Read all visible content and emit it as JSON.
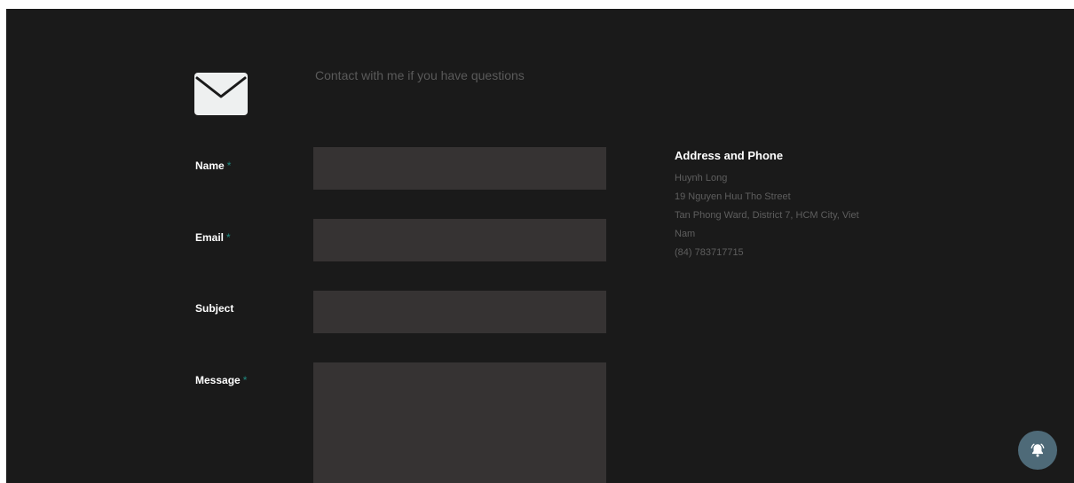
{
  "header": {
    "icon": "envelope-icon",
    "intro_text": "Contact with me if you have questions"
  },
  "form": {
    "required_mark": "*",
    "fields": [
      {
        "label": "Name",
        "required": true,
        "value": "",
        "type": "text"
      },
      {
        "label": "Email",
        "required": true,
        "value": "",
        "type": "email"
      },
      {
        "label": "Subject",
        "required": false,
        "value": "",
        "type": "text"
      },
      {
        "label": "Message",
        "required": true,
        "value": "",
        "type": "textarea"
      }
    ]
  },
  "contact": {
    "title": "Address and Phone",
    "name": "Huynh Long",
    "street": "19 Nguyen Huu Tho Street",
    "address_line_1": "Tan Phong Ward, District 7, HCM City, Viet",
    "address_line_2": "Nam",
    "phone": "(84) 783717715"
  },
  "floating_button": {
    "icon": "bell-icon"
  },
  "colors": {
    "page_background": "#1a1a1a",
    "input_background": "#363333",
    "required_accent": "#1f8a80",
    "muted_text": "#5e5e5e",
    "button_background": "#4e6a78"
  }
}
